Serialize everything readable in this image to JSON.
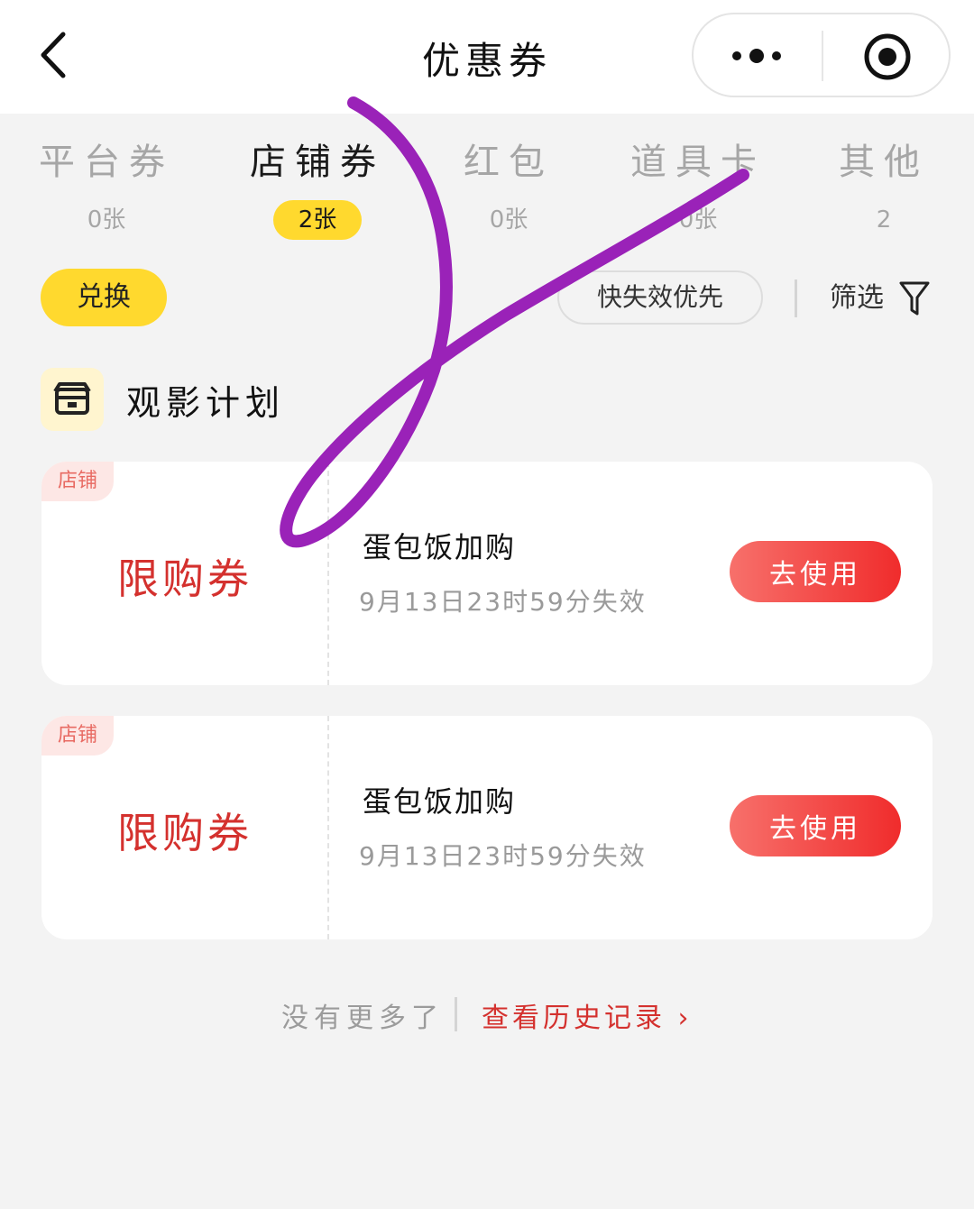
{
  "header": {
    "title": "优惠券",
    "icons": {
      "back": "chevron-left-icon",
      "more": "more-dots-icon",
      "close": "close-circle-icon"
    }
  },
  "tabs": [
    {
      "label": "平台券",
      "count": "0张",
      "active": false
    },
    {
      "label": "店铺券",
      "count": "2张",
      "active": true
    },
    {
      "label": "红包",
      "count": "0张",
      "active": false
    },
    {
      "label": "道具卡",
      "count": "0张",
      "active": false
    },
    {
      "label": "其他",
      "count": "2",
      "active": false
    }
  ],
  "toolbar": {
    "redeem_label": "兑换",
    "sort_label": "快失效优先",
    "filter_label": "筛选"
  },
  "store": {
    "name": "观影计划",
    "icon": "storefront-icon"
  },
  "coupons": [
    {
      "tag": "店铺",
      "type": "限购券",
      "title": "蛋包饭加购",
      "expiry": "9月13日23时59分失效",
      "action": "去使用"
    },
    {
      "tag": "店铺",
      "type": "限购券",
      "title": "蛋包饭加购",
      "expiry": "9月13日23时59分失效",
      "action": "去使用"
    }
  ],
  "footer": {
    "no_more": "没有更多了",
    "history_link": "查看历史记录 ›"
  },
  "colors": {
    "accent_yellow": "#ffd92e",
    "accent_red": "#d4312e",
    "button_gradient_start": "#f7706b",
    "button_gradient_end": "#f02c2c",
    "annotation_purple": "#9a22b8"
  }
}
